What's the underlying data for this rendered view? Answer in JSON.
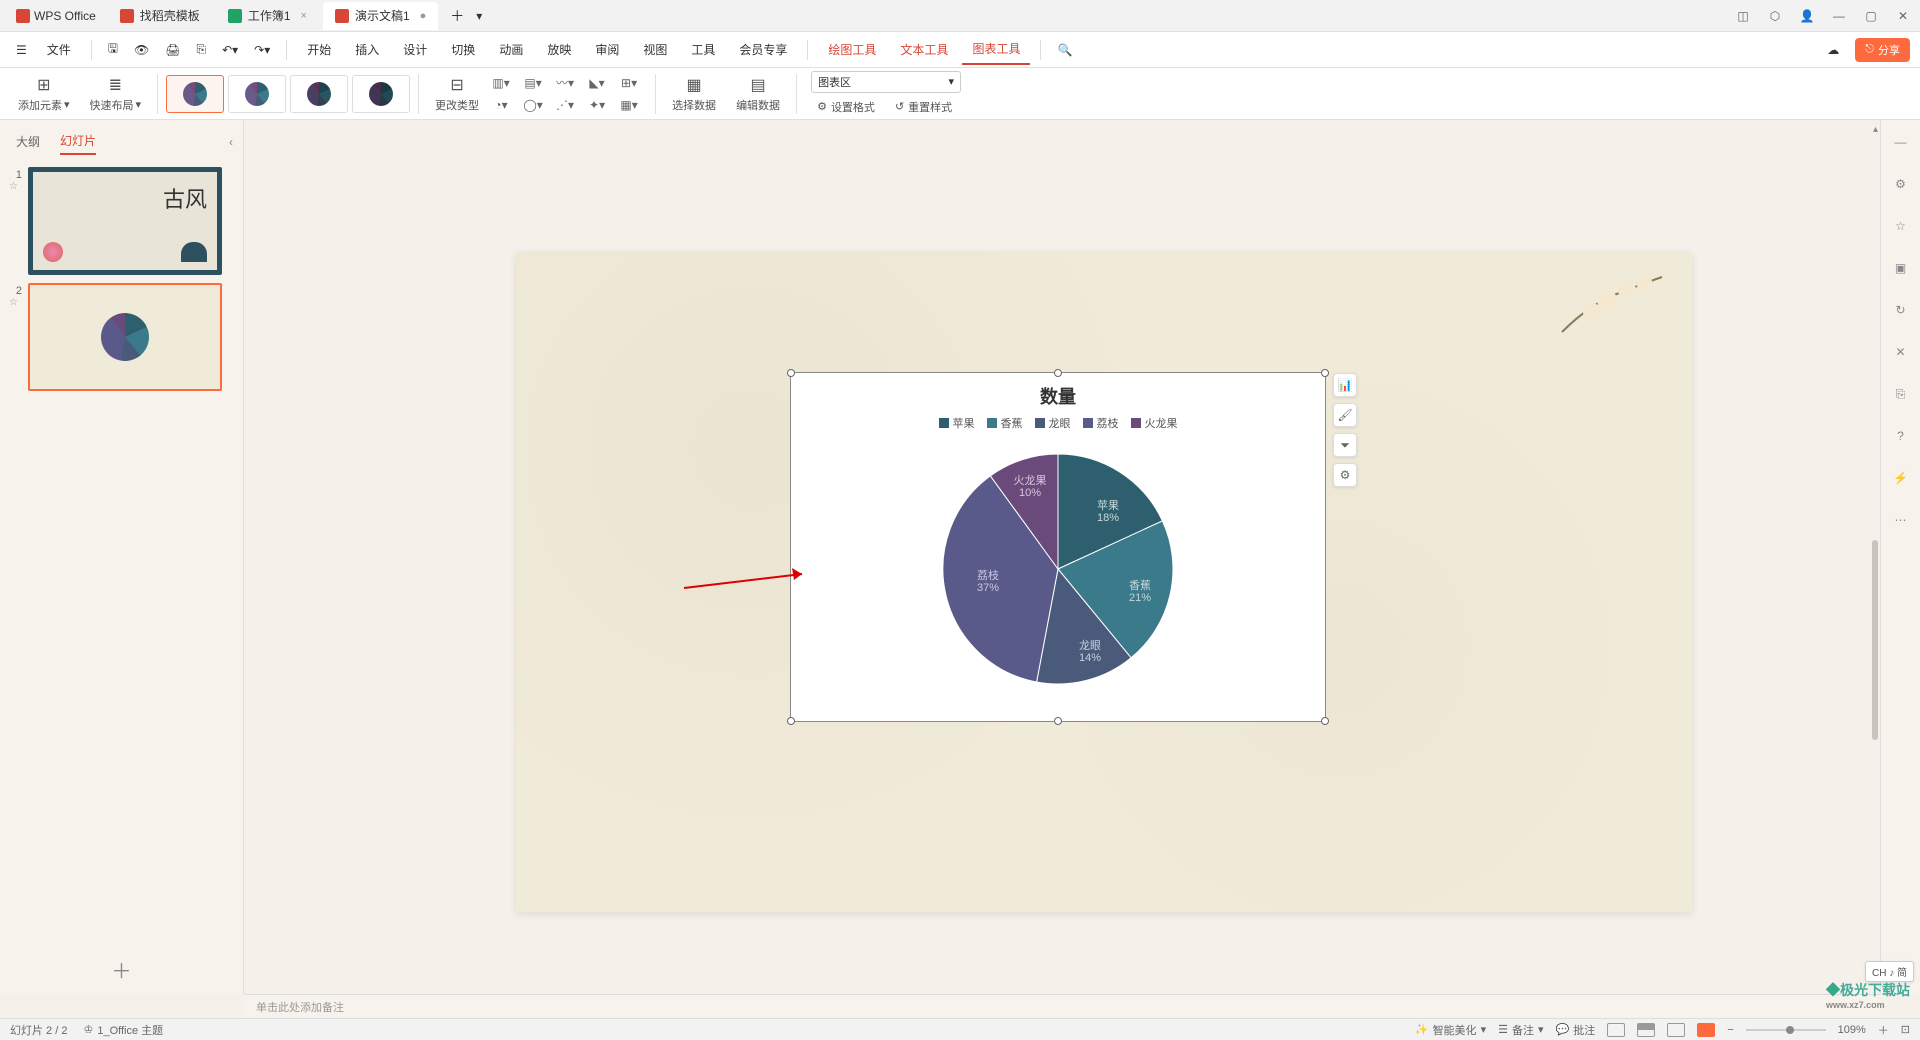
{
  "app_name": "WPS Office",
  "tabs": [
    {
      "label": "找稻壳模板",
      "icon_color": "#d94635"
    },
    {
      "label": "工作簿1",
      "icon_color": "#21a366"
    },
    {
      "label": "演示文稿1",
      "icon_color": "#d94635",
      "active": true
    }
  ],
  "file_menu": "文件",
  "menu": {
    "start": "开始",
    "insert": "插入",
    "design": "设计",
    "transition": "切换",
    "animation": "动画",
    "slideshow": "放映",
    "review": "审阅",
    "view": "视图",
    "tools": "工具",
    "member": "会员专享",
    "draw_tools": "绘图工具",
    "text_tools": "文本工具",
    "chart_tools": "图表工具"
  },
  "share_label": "分享",
  "ribbon": {
    "add_element": "添加元素",
    "quick_layout": "快速布局",
    "change_type": "更改类型",
    "select_data": "选择数据",
    "edit_data": "编辑数据",
    "chart_area": "图表区",
    "set_format": "设置格式",
    "reset_style": "重置样式"
  },
  "sidebar": {
    "outline": "大纲",
    "slides": "幻灯片"
  },
  "chart_data": {
    "type": "pie",
    "title": "数量",
    "series_name": "数量",
    "categories": [
      "苹果",
      "香蕉",
      "龙眼",
      "荔枝",
      "火龙果"
    ],
    "values": [
      18,
      21,
      14,
      37,
      10
    ],
    "colors": [
      "#2d5f6f",
      "#3a7a8a",
      "#4a5a7a",
      "#5a5a8a",
      "#6a4a7a"
    ],
    "labels": {
      "apple": {
        "name": "苹果",
        "pct": "18%"
      },
      "banana": {
        "name": "香蕉",
        "pct": "21%"
      },
      "longan": {
        "name": "龙眼",
        "pct": "14%"
      },
      "lychee": {
        "name": "荔枝",
        "pct": "37%"
      },
      "pitaya": {
        "name": "火龙果",
        "pct": "10%"
      }
    }
  },
  "notes_placeholder": "单击此处添加备注",
  "status": {
    "slide_indicator": "幻灯片 2 / 2",
    "theme": "1_Office 主题",
    "smart_beautify": "智能美化",
    "notes": "备注",
    "comments": "批注",
    "zoom": "109%"
  },
  "ime": "CH ♪ 简",
  "watermark": {
    "name": "极光下载站",
    "url": "www.xz7.com"
  }
}
